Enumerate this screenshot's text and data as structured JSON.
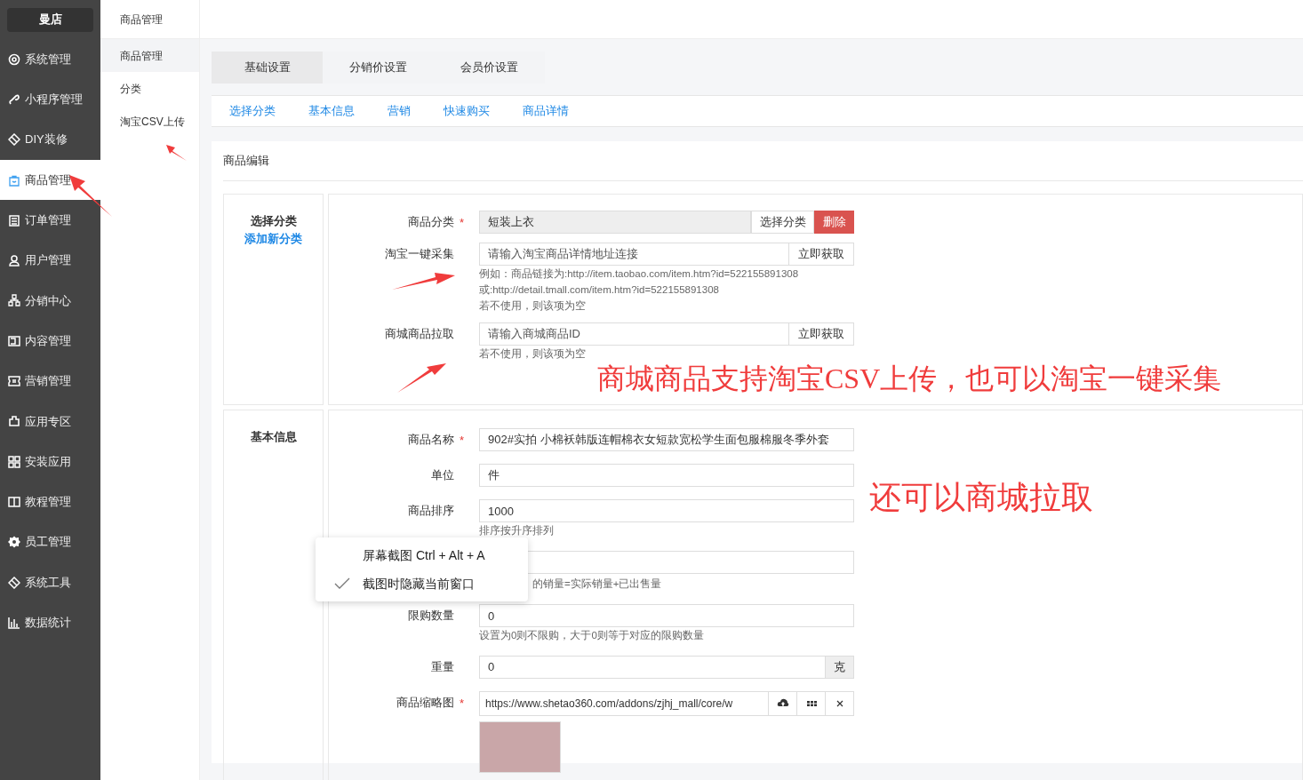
{
  "sidebar": {
    "brand": "曼店",
    "items": [
      {
        "label": "系统管理",
        "selected": false
      },
      {
        "label": "小程序管理",
        "selected": false
      },
      {
        "label": "DIY装修",
        "selected": false
      },
      {
        "label": "商品管理",
        "selected": true
      },
      {
        "label": "订单管理",
        "selected": false
      },
      {
        "label": "用户管理",
        "selected": false
      },
      {
        "label": "分销中心",
        "selected": false
      },
      {
        "label": "内容管理",
        "selected": false
      },
      {
        "label": "营销管理",
        "selected": false
      },
      {
        "label": "应用专区",
        "selected": false
      },
      {
        "label": "安装应用",
        "selected": false
      },
      {
        "label": "教程管理",
        "selected": false
      },
      {
        "label": "员工管理",
        "selected": false
      },
      {
        "label": "系统工具",
        "selected": false
      },
      {
        "label": "数据统计",
        "selected": false
      }
    ]
  },
  "submenu": {
    "title": "商品管理",
    "items": [
      {
        "label": "商品管理",
        "selected": true
      },
      {
        "label": "分类",
        "selected": false
      },
      {
        "label": "淘宝CSV上传",
        "selected": false
      }
    ]
  },
  "tabs": [
    {
      "label": "基础设置",
      "selected": true
    },
    {
      "label": "分销价设置",
      "selected": false
    },
    {
      "label": "会员价设置",
      "selected": false
    }
  ],
  "anchors": [
    "选择分类",
    "基本信息",
    "营销",
    "快速购买",
    "商品详情"
  ],
  "section_title": "商品编辑",
  "category_card": {
    "title": "选择分类",
    "link": "添加新分类",
    "fields": [
      {
        "kind": "select",
        "label": "商品分类",
        "required_mark": "*",
        "value": "短装上衣",
        "button": "选择分类",
        "delete_button": "删除"
      },
      {
        "kind": "fetch",
        "label": "淘宝一键采集",
        "placeholder": "请输入淘宝商品详情地址连接",
        "button": "立即获取",
        "hints": [
          "例如：商品链接为:http://item.taobao.com/item.htm?id=522155891308",
          "或:http://detail.tmall.com/item.htm?id=522155891308",
          "若不使用，则该项为空"
        ]
      },
      {
        "kind": "fetch",
        "label": "商城商品拉取",
        "placeholder": "请输入商城商品ID",
        "button": "立即获取",
        "hints": [
          "若不使用，则该项为空"
        ]
      }
    ]
  },
  "basic_card": {
    "title": "基本信息",
    "fields": [
      {
        "kind": "text",
        "label": "商品名称",
        "required_mark": "*",
        "value": "902#实拍 小棉袄韩版连帽棉衣女短款宽松学生面包服棉服冬季外套"
      },
      {
        "kind": "text",
        "label": "单位",
        "value": "件"
      },
      {
        "kind": "text",
        "label": "商品排序",
        "value": "1000",
        "hints": [
          "排序按升序排列"
        ]
      },
      {
        "kind": "covered",
        "hints": [
          "的销量=实际销量+已出售量"
        ]
      },
      {
        "kind": "text",
        "label": "限购数量",
        "value": "0",
        "hints": [
          "设置为0则不限购，大于0则等于对应的限购数量"
        ]
      },
      {
        "kind": "addon",
        "label": "重量",
        "value": "0",
        "addon": "克"
      },
      {
        "kind": "image",
        "label": "商品缩略图",
        "required_mark": "*",
        "value": "https://www.shetao360.com/addons/zjhj_mall/core/w"
      }
    ]
  },
  "context_menu": {
    "items": [
      {
        "label": "屏幕截图 Ctrl + Alt + A",
        "checked": false
      },
      {
        "label": "截图时隐藏当前窗口",
        "checked": true
      }
    ]
  },
  "annotations": [
    "商城商品支持淘宝CSV上传，也可以淘宝一键采集",
    "还可以商城拉取"
  ]
}
